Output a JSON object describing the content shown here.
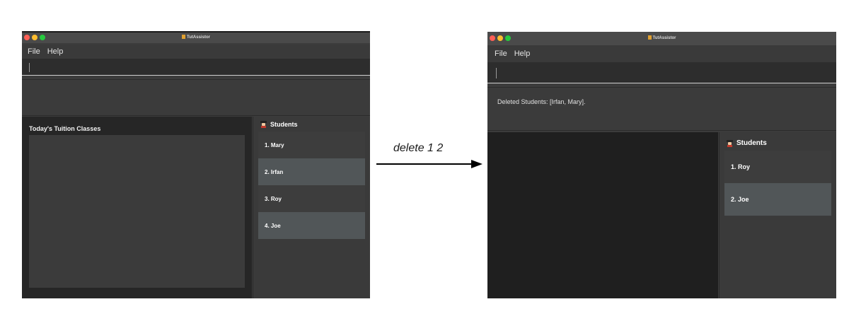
{
  "before": {
    "window_title": "TutAssistor",
    "menu": [
      "File",
      "Help"
    ],
    "command_input": "",
    "result_text": "",
    "classes_title": "Today's Tuition Classes",
    "students_title": "Students",
    "students": [
      "1.  Mary",
      "2.  Irfan",
      "3.  Roy",
      "4.  Joe"
    ]
  },
  "command_label": "delete 1 2",
  "after": {
    "window_title": "TutAssistor",
    "menu": [
      "File",
      "Help"
    ],
    "command_input": "",
    "result_text": "Deleted Students: [Irfan, Mary].",
    "students_title": "Students",
    "students": [
      "1.  Roy",
      "2.  Joe"
    ]
  },
  "colors": {
    "window_bg": "#3c3c3c",
    "panel_dark": "#262626",
    "card_highlight": "#515658",
    "arrow": "#000000"
  },
  "icons": {
    "students": "student-icon",
    "app": "app-icon"
  }
}
